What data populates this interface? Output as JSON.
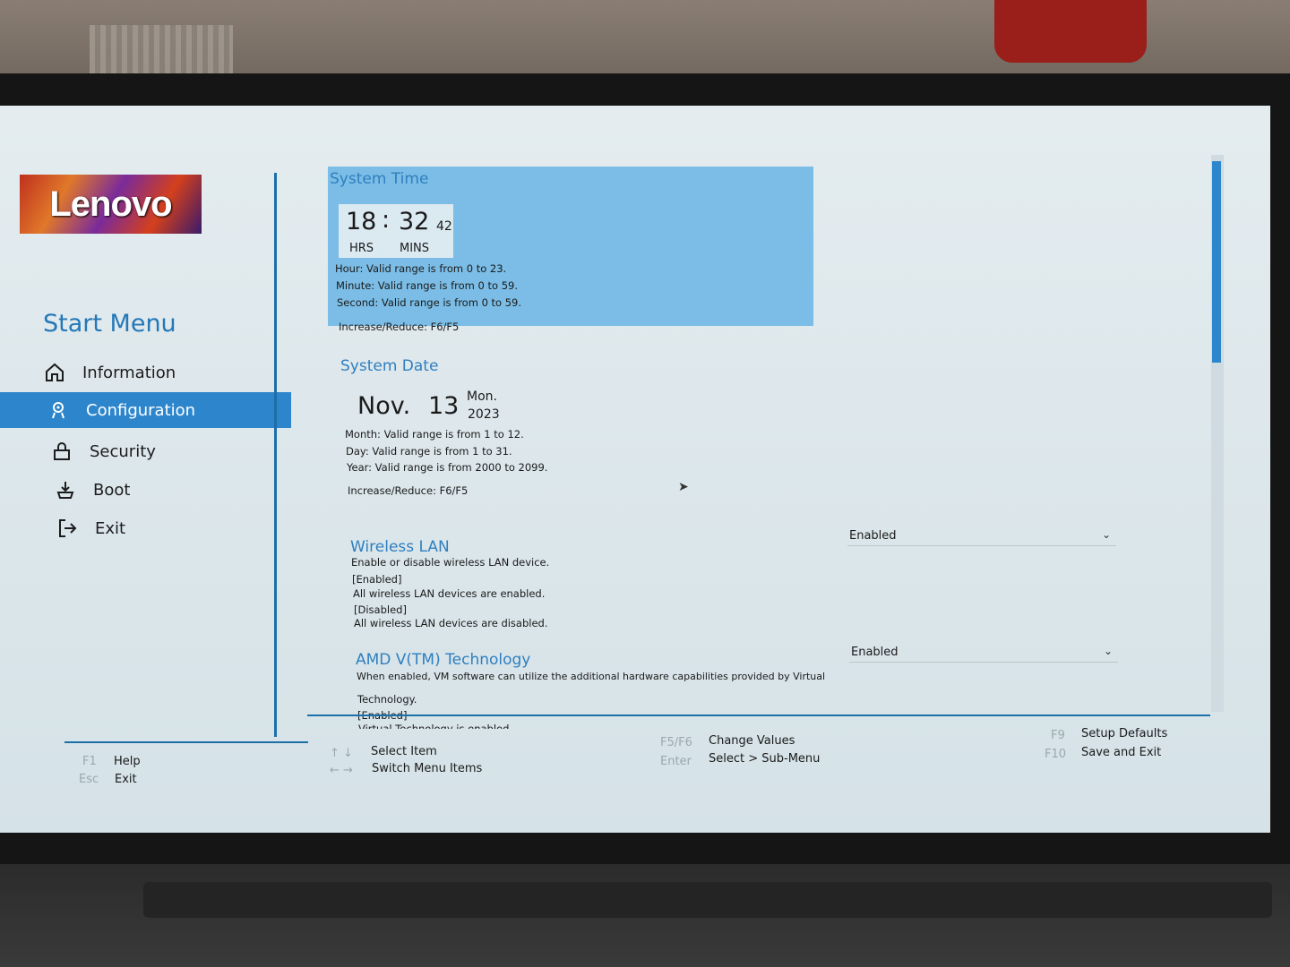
{
  "brand": {
    "logo_text": "Lenovo"
  },
  "sidebar": {
    "title": "Start Menu",
    "items": [
      {
        "label": "Information",
        "icon": "home-icon"
      },
      {
        "label": "Configuration",
        "icon": "gear-icon",
        "active": true
      },
      {
        "label": "Security",
        "icon": "lock-icon"
      },
      {
        "label": "Boot",
        "icon": "boot-icon"
      },
      {
        "label": "Exit",
        "icon": "exit-icon"
      }
    ]
  },
  "system_time": {
    "title": "System Time",
    "hours": "18",
    "separator": ":",
    "minutes": "32",
    "seconds": "42",
    "hrs_label": "HRS",
    "mins_label": "MINS",
    "hint_hour": "Hour: Valid range is from 0 to 23.",
    "hint_minute": "Minute: Valid range is from 0 to 59.",
    "hint_second": "Second: Valid range is from 0 to 59.",
    "increase": "Increase/Reduce: F6/F5"
  },
  "system_date": {
    "title": "System Date",
    "month": "Nov.",
    "day": "13",
    "weekday": "Mon.",
    "year": "2023",
    "hint_month": "Month: Valid range is from 1 to 12.",
    "hint_day": "Day: Valid range is from 1 to 31.",
    "hint_year": "Year: Valid range is from 2000 to 2099.",
    "increase": "Increase/Reduce: F6/F5"
  },
  "wireless_lan": {
    "title": "Wireless LAN",
    "value": "Enabled",
    "desc1": "Enable or disable wireless LAN device.",
    "desc2": "[Enabled]",
    "desc3": "All wireless LAN devices are enabled.",
    "desc4": "[Disabled]",
    "desc5": "All wireless LAN devices are disabled."
  },
  "amd_vt": {
    "title": "AMD V(TM) Technology",
    "value": "Enabled",
    "desc1": "When enabled, VM software can utilize the additional hardware capabilities provided by Virtual",
    "desc2": "Technology.",
    "desc3": "[Enabled]",
    "desc4": "Virtual Technology is enabled."
  },
  "footer": {
    "f1_key": "F1",
    "f1_desc": "Help",
    "esc_key": "Esc",
    "esc_desc": "Exit",
    "updown_key": "↑ ↓",
    "updown_desc": "Select Item",
    "leftright_key": "← →",
    "leftright_desc": "Switch Menu Items",
    "f5f6_key": "F5/F6",
    "f5f6_desc": "Change Values",
    "enter_key": "Enter",
    "enter_desc": "Select > Sub-Menu",
    "f9_key": "F9",
    "f9_desc": "Setup Defaults",
    "f10_key": "F10",
    "f10_desc": "Save and Exit"
  },
  "colors": {
    "accent": "#2d86cc",
    "highlight": "#7bbde6",
    "title": "#2f7fbf"
  }
}
